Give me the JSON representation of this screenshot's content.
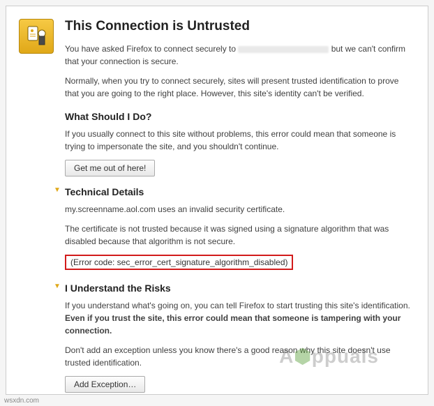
{
  "icon": "untrusted-cert-icon",
  "title": "This Connection is Untrusted",
  "intro1_a": "You have asked Firefox to connect securely to ",
  "intro1_b": " but we can't confirm that your connection is secure.",
  "intro2": "Normally, when you try to connect securely, sites will present trusted identification to prove that you are going to the right place. However, this site's identity can't be verified.",
  "what_heading": "What Should I Do?",
  "what_text": "If you usually connect to this site without problems, this error could mean that someone is trying to impersonate the site, and you shouldn't continue.",
  "getout_label": "Get me out of here!",
  "tech_heading": "Technical Details",
  "tech_text1": "my.screenname.aol.com uses an invalid security certificate.",
  "tech_text2": "The certificate is not trusted because it was signed using a signature algorithm that was disabled because that algorithm is not secure.",
  "error_code": "(Error code: sec_error_cert_signature_algorithm_disabled)",
  "risks_heading": "I Understand the Risks",
  "risks_text1_a": "If you understand what's going on, you can tell Firefox to start trusting this site's identification. ",
  "risks_text1_b": "Even if you trust the site, this error could mean that someone is tampering with your connection.",
  "risks_text2": "Don't add an exception unless you know there's a good reason why this site doesn't use trusted identification.",
  "add_exception_label": "Add Exception…",
  "watermark": "A  ppuals",
  "source_note": "wsxdn.com"
}
